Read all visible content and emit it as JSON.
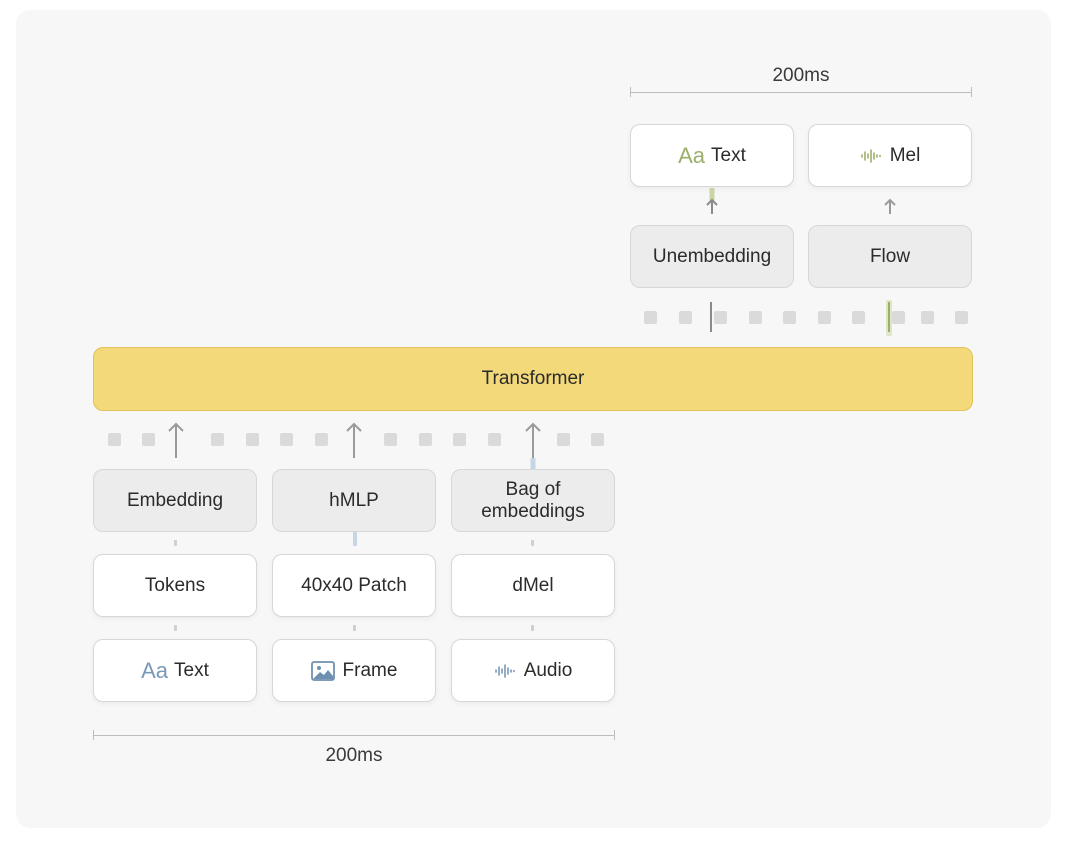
{
  "top_scale": {
    "label": "200ms"
  },
  "bottom_scale": {
    "label": "200ms"
  },
  "transformer": {
    "label": "Transformer"
  },
  "outputs": {
    "text": {
      "prefix": "Aa",
      "label": "Text"
    },
    "mel": {
      "label": "Mel"
    },
    "unembedding": {
      "label": "Unembedding"
    },
    "flow": {
      "label": "Flow"
    }
  },
  "inputs": {
    "embedding": {
      "label": "Embedding"
    },
    "hmlp": {
      "label": "hMLP"
    },
    "bag": {
      "label_line1": "Bag of",
      "label_line2": "embeddings"
    },
    "tokens": {
      "label": "Tokens"
    },
    "patch": {
      "label": "40x40 Patch"
    },
    "dmel": {
      "label": "dMel"
    },
    "text": {
      "prefix": "Aa",
      "label": "Text"
    },
    "frame": {
      "label": "Frame"
    },
    "audio": {
      "label": "Audio"
    }
  },
  "colors": {
    "transformer_fill": "#f3d97a",
    "text_accent_green": "#9caf6a",
    "text_accent_blue": "#7a98b8"
  },
  "icons": [
    "waveform-icon",
    "image-icon",
    "arrow-up-icon"
  ]
}
